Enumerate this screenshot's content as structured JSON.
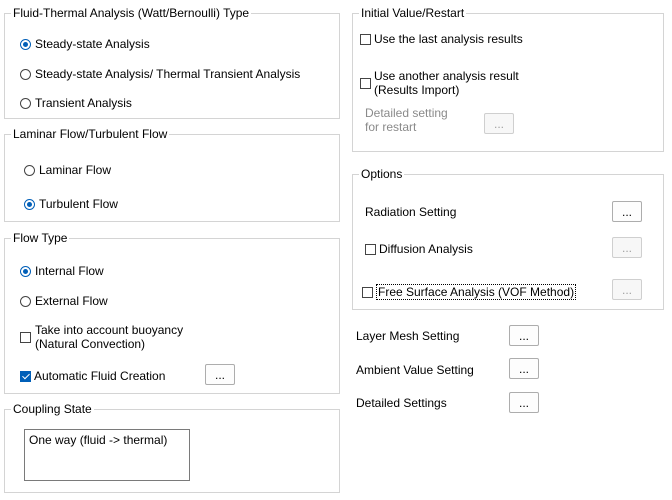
{
  "fluid_thermal": {
    "title": "Fluid-Thermal Analysis (Watt/Bernoulli) Type",
    "options": [
      {
        "label": "Steady-state Analysis",
        "selected": true
      },
      {
        "label": "Steady-state Analysis/ Thermal Transient Analysis",
        "selected": false
      },
      {
        "label": "Transient Analysis",
        "selected": false
      }
    ]
  },
  "flow_regime": {
    "title": "Laminar Flow/Turbulent Flow",
    "options": [
      {
        "label": "Laminar Flow",
        "selected": false
      },
      {
        "label": "Turbulent Flow",
        "selected": true
      }
    ]
  },
  "flow_type": {
    "title": "Flow Type",
    "internal": "Internal Flow",
    "external": "External Flow",
    "buoyancy_line1": "Take into account buoyancy",
    "buoyancy_line2": "(Natural Convection)",
    "auto_fluid": "Automatic Fluid Creation",
    "more_button": "..."
  },
  "coupling": {
    "title": "Coupling State",
    "value": "One way (fluid -> thermal)"
  },
  "initial_value": {
    "title": "Initial Value/Restart",
    "use_last": "Use the last analysis results",
    "use_another_line1": "Use another analysis result",
    "use_another_line2": "(Results Import)",
    "detailed_line1": "Detailed setting",
    "detailed_line2": "for restart",
    "more_button": "..."
  },
  "options": {
    "title": "Options",
    "radiation": "Radiation Setting",
    "diffusion": "Diffusion Analysis",
    "free_surface": "Free Surface Analysis (VOF Method)",
    "more_button": "..."
  },
  "settings": {
    "layer_mesh": "Layer Mesh Setting",
    "ambient_value": "Ambient Value Setting",
    "detailed": "Detailed Settings",
    "more_button": "..."
  }
}
